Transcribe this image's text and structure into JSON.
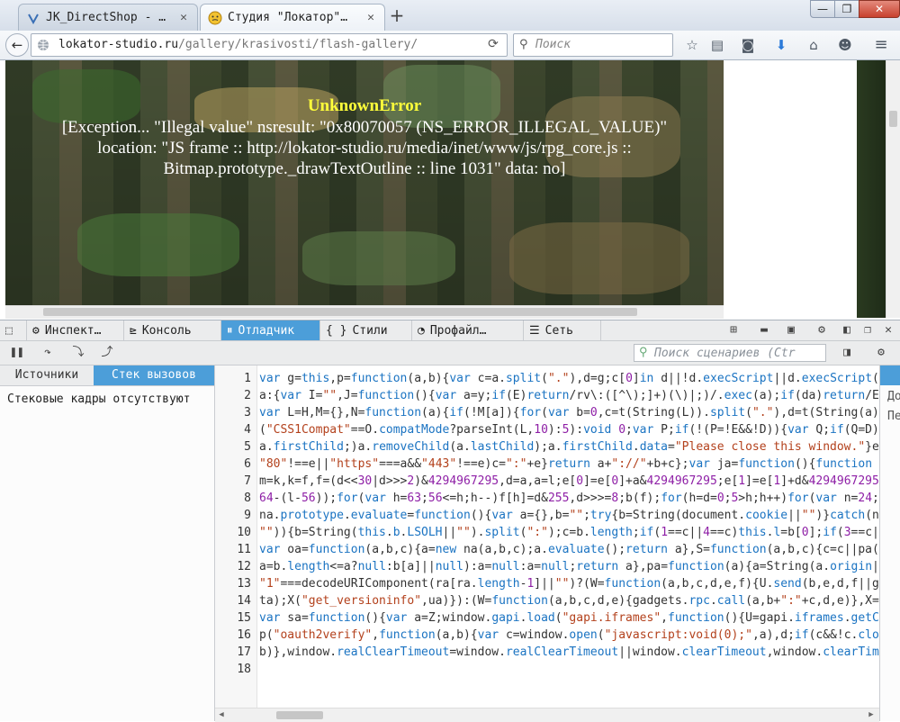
{
  "browser": {
    "tabs": [
      {
        "title": "JK_DirectShop - …",
        "active": false
      },
      {
        "title": "Студия \"Локатор\"…",
        "active": true
      }
    ],
    "new_tab_symbol": "+",
    "window_controls": {
      "minimize": "—",
      "maximize": "❐",
      "close": "✕"
    },
    "url": {
      "host": "lokator-studio.ru",
      "path": "/gallery/krasivosti/flash-gallery/"
    },
    "search_placeholder": "Поиск"
  },
  "page": {
    "error_title": "UnknownError",
    "error_lines": [
      "[Exception... \"Illegal value\"  nsresult: \"0x80070057 (NS_ERROR_ILLEGAL_VALUE)\"",
      "location: \"JS frame :: http://lokator-studio.ru/media/inet/www/js/rpg_core.js ::",
      "Bitmap.prototype._drawTextOutline :: line 1031\"  data: no]"
    ]
  },
  "devtools": {
    "tabs": [
      {
        "label": "Инспект…",
        "icon": "inspector-icon"
      },
      {
        "label": "Консоль",
        "icon": "console-icon"
      },
      {
        "label": "Отладчик",
        "icon": "debugger-icon",
        "active": true
      },
      {
        "label": "Стили",
        "icon": "style-editor-icon"
      },
      {
        "label": "Профайл…",
        "icon": "profiler-icon"
      },
      {
        "label": "Сеть",
        "icon": "network-icon"
      }
    ],
    "script_search_placeholder": "Поиск сценариев (Ctr",
    "left_tabs": [
      {
        "label": "Источники",
        "active": false
      },
      {
        "label": "Стек вызовов",
        "active": true
      }
    ],
    "no_frames_text": "Стековые кадры отсутствуют",
    "right_pane_fragments": [
      "До",
      "Пе"
    ],
    "code_lines": [
      "var g=this,p=function(a,b){var c=a.split(\".\"),d=g;c[0]in d||!d.execScript||d.execScript(",
      "a:{var I=\"\",J=function(){var a=y;if(E)return/rv\\:([^\\);]+)(\\)|;)/.exec(a);if(da)return/E",
      "var L=H,M={},N=function(a){if(!M[a]){for(var b=0,c=t(String(L)).split(\".\"),d=t(String(a)",
      "(\"CSS1Compat\"==O.compatMode?parseInt(L,10):5):void 0;var P;if(!(P=!E&&!D)){var Q;if(Q=D)",
      "a.firstChild;)a.removeChild(a.lastChild);a.firstChild.data=\"Please close this window.\"}e",
      "\"80\"!==e||\"https\"===a&&\"443\"!==e)c=\":\"+e}return a+\"://\"+b+c};var ja=function(){function",
      "m=k,k=f,f=(d<<30|d>>>2)&4294967295,d=a,a=l;e[0]=e[0]+a&4294967295;e[1]=e[1]+d&4294967295",
      "64-(l-56));for(var h=63;56<=h;h--)f[h]=d&255,d>>>=8;b(f);for(h=d=0;5>h;h++)for(var n=24;",
      "na.prototype.evaluate=function(){var a={},b=\"\";try{b=String(document.cookie||\"\")}catch(n",
      "\"\")){b=String(this.b.LSOLH||\"\").split(\":\");c=b.length;if(1==c||4==c)this.l=b[0];if(3==c|",
      "var oa=function(a,b,c){a=new na(a,b,c);a.evaluate();return a},S=function(a,b,c){c=c||pa(",
      "a=b.length<=a?null:b[a]||null):a=null:a=null;return a},pa=function(a){a=String(a.origin|",
      "\"1\"===decodeURIComponent(ra[ra.length-1]||\"\")?(W=function(a,b,c,d,e,f){U.send(b,e,d,f||g",
      "ta);X(\"get_versioninfo\",ua)}):(W=function(a,b,c,d,e){gadgets.rpc.call(a,b+\":\"+c,d,e)},X=",
      "var sa=function(){var a=Z;window.gapi.load(\"gapi.iframes\",function(){U=gapi.iframes.getC",
      "p(\"oauth2verify\",function(a,b){var c=window.open(\"javascript:void(0);\",a),d;if(c&&!c.clo",
      "b)},window.realClearTimeout=window.realClearTimeout||window.clearTimeout,window.clearTim",
      ""
    ]
  },
  "colors": {
    "accent": "#4c9ed9",
    "error_title": "#ffff3a",
    "keyword": "#1a73c2",
    "string": "#b3411c",
    "number": "#8e1fa6"
  }
}
